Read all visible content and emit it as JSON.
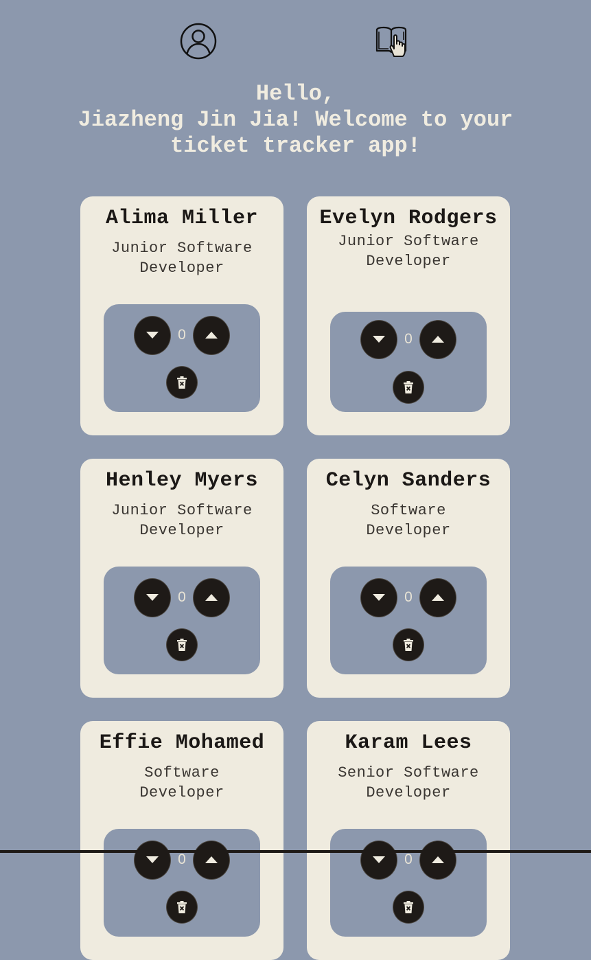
{
  "nav": {
    "profile_icon": "user-circle-icon",
    "tickets_icon": "book-hand-icon"
  },
  "greeting": {
    "line1": "Hello,",
    "line2": "Jiazheng Jin Jia! Welcome to your ticket tracker app!"
  },
  "employees": [
    {
      "name": "Alima Miller",
      "role": "Junior Software Developer",
      "count": "0"
    },
    {
      "name": "Evelyn Rodgers",
      "role": "Junior Software Developer",
      "count": "0"
    },
    {
      "name": "Henley Myers",
      "role": "Junior Software Developer",
      "count": "0"
    },
    {
      "name": "Celyn Sanders",
      "role": "Software Developer",
      "count": "0"
    },
    {
      "name": "Effie Mohamed",
      "role": "Software Developer",
      "count": "0"
    },
    {
      "name": "Karam Lees",
      "role": "Senior Software Developer",
      "count": "0"
    }
  ],
  "icons": {
    "decrement": "caret-down-icon",
    "increment": "caret-up-icon",
    "delete": "trash-icon"
  },
  "colors": {
    "background": "#8c98ad",
    "card": "#efebdf",
    "button": "#1e1a17",
    "greeting_text": "#f0ece0"
  }
}
